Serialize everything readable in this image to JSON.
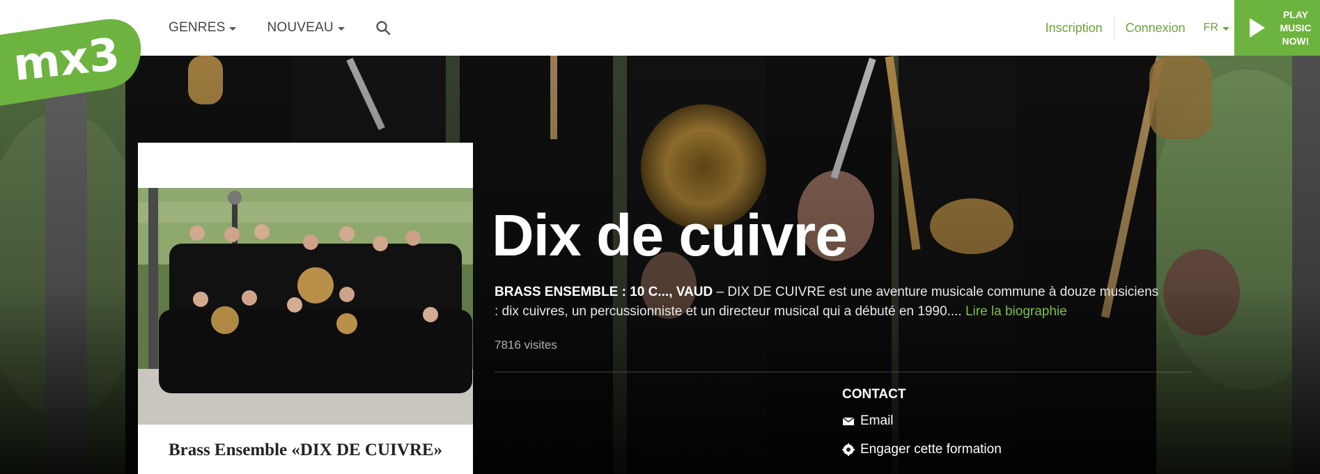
{
  "brand": {
    "logo_text": "mx3",
    "accent_color": "#6db33f"
  },
  "nav": {
    "genres_label": "GENRES",
    "nouveau_label": "NOUVEAU",
    "inscription_label": "Inscription",
    "connexion_label": "Connexion",
    "language_label": "FR",
    "play_line1": "PLAY",
    "play_line2": "MUSIC",
    "play_line3": "NOW!"
  },
  "artist": {
    "name": "Dix de cuivre",
    "tagline": "BRASS ENSEMBLE : 10 C..., VAUD",
    "bio_text": " – DIX DE CUIVRE est une aventure musicale commune à douze musiciens : dix cuivres, un percussionniste et un directeur musical qui a débuté en 1990.... ",
    "bio_link": "Lire la biographie",
    "visits": "7816 visites",
    "cover_caption": "Brass Ensemble «DIX DE CUIVRE»"
  },
  "contact": {
    "heading": "CONTACT",
    "email_label": "Email",
    "hire_label": "Engager cette formation"
  },
  "icons": {
    "search": "search-icon",
    "play": "play-icon",
    "email": "envelope-icon",
    "hire": "gear-badge-icon"
  }
}
